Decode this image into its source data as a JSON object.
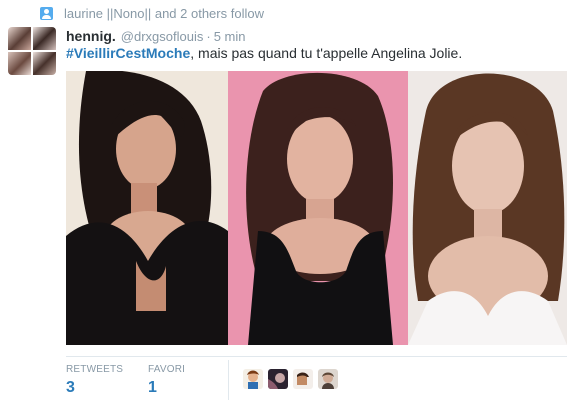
{
  "social_context": {
    "icon": "person-icon",
    "text": "laurine ||Nono|| and 2 others follow"
  },
  "tweet": {
    "fullname": "hennig.",
    "username": "@drxgsoflouis",
    "separator": "·",
    "timestamp": "5 min",
    "hashtag": "#VieillirCestMoche",
    "text": ", mais pas quand tu t'appelle Angelina Jolie.",
    "hashtag_color": "#2b7bb9"
  },
  "stats": {
    "retweets_label": "RETWEETS",
    "retweets_count": "3",
    "favorites_label": "FAVORI",
    "favorites_count": "1",
    "accent": "#2b7bb9"
  },
  "favoriters": [
    "favoriter-avatar-1",
    "favoriter-avatar-2",
    "favoriter-avatar-3",
    "favoriter-avatar-4"
  ]
}
